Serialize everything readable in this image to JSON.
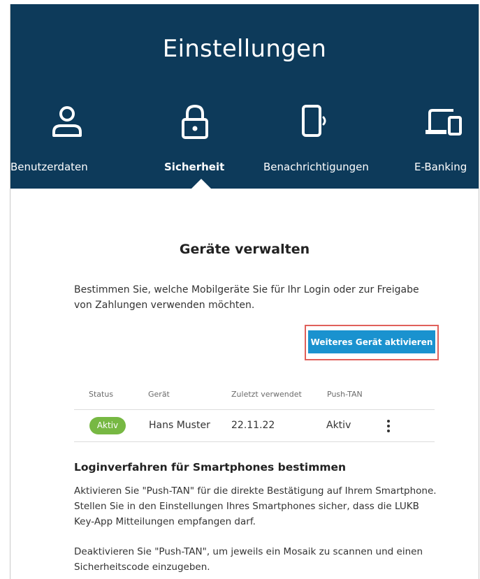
{
  "header": {
    "title": "Einstellungen",
    "background": "#0d3a5a",
    "tabs": [
      {
        "label": "Benutzerdaten",
        "icon": "user-icon",
        "active": false
      },
      {
        "label": "Sicherheit",
        "icon": "lock-icon",
        "active": true
      },
      {
        "label": "Benachrichtigungen",
        "icon": "phone-notification-icon",
        "active": false
      },
      {
        "label": "E-Banking",
        "icon": "devices-icon",
        "active": false
      }
    ]
  },
  "devices": {
    "title": "Geräte verwalten",
    "intro": "Bestimmen Sie, welche Mobilgeräte Sie für Ihr Login oder zur Freigabe von Zahlungen verwenden möchten.",
    "activate_button": "Weiteres Gerät aktivieren",
    "button_color": "#1a92cf",
    "highlight_color": "#e0605a",
    "columns": [
      "Status",
      "Gerät",
      "Zuletzt verwendet",
      "Push-TAN"
    ],
    "rows": [
      {
        "status": "Aktiv",
        "device": "Hans Muster",
        "last_used": "22.11.22",
        "push_tan": "Aktiv",
        "status_color": "#77b843"
      }
    ]
  },
  "login_methods": {
    "title": "Loginverfahren für Smartphones bestimmen",
    "paragraphs": [
      "Aktivieren Sie \"Push-TAN\" für die direkte Bestätigung auf Ihrem Smartphone. Stellen Sie in den Einstellungen Ihres Smartphones sicher, dass die LUKB Key-App Mitteilungen empfangen darf.",
      "Deaktivieren Sie \"Push-TAN\", um jeweils ein Mosaik zu scannen und einen Sicherheitscode einzugeben."
    ]
  }
}
